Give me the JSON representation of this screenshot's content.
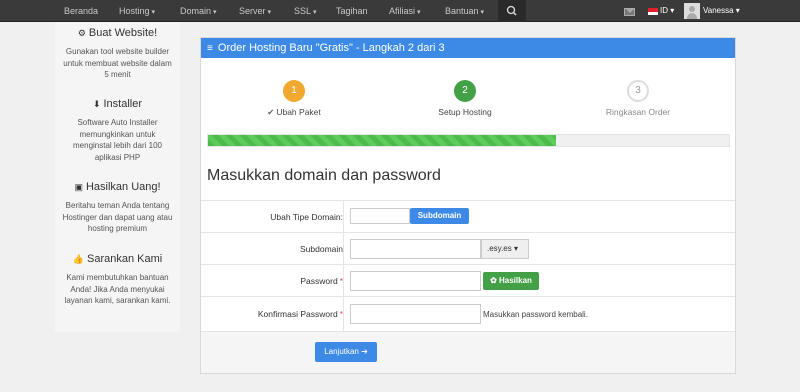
{
  "nav": {
    "items": [
      {
        "label": "Beranda",
        "caret": ""
      },
      {
        "label": "Hosting",
        "caret": "▾"
      },
      {
        "label": "Domain",
        "caret": "▾"
      },
      {
        "label": "Server",
        "caret": "▾"
      },
      {
        "label": "SSL",
        "caret": "▾"
      },
      {
        "label": "Tagihan",
        "caret": ""
      },
      {
        "label": "Afiliasi",
        "caret": "▾"
      },
      {
        "label": "Bantuan",
        "caret": "▾"
      }
    ],
    "search_icon": "⌕",
    "mail_icon": "mail-icon",
    "language": "ID ▾",
    "username": "Vanessa",
    "user_caret": "▾"
  },
  "sidebar": {
    "blocks": [
      {
        "icon": "⚙",
        "title": "Buat Website!",
        "text": "Gunakan tool website builder untuk membuat website dalam 5 menit"
      },
      {
        "icon": "⬇",
        "title": "Installer",
        "text": "Software Auto Installer memungkinkan untuk menginstal lebih dari 100 aplikasi PHP"
      },
      {
        "icon": "▣",
        "title": "Hasilkan Uang!",
        "text": "Beritahu teman Anda tentang Hostinger dan dapat uang atau hosting premium"
      },
      {
        "icon": "👍",
        "title": "Sarankan Kami",
        "text": "Kami membutuhkan bantuan Anda! Jika Anda menyukai layanan kami, sarankan kami."
      }
    ]
  },
  "panel": {
    "icon": "≡",
    "title": "Order Hosting Baru \"Gratis\" - Langkah 2 dari 3"
  },
  "steps": [
    {
      "number": "1",
      "label": "Ubah Paket",
      "check": "✔",
      "color": "#f0a830"
    },
    {
      "number": "2",
      "label": "Setup Hosting",
      "check": "",
      "color": "#43a047"
    },
    {
      "number": "3",
      "label": "Ringkasan Order",
      "check": "",
      "color": "#ffffff"
    }
  ],
  "progress": {
    "fraction": 0.667
  },
  "section_title": "Masukkan domain dan password",
  "form": {
    "domain_type_label": "Ubah Tipe Domain:",
    "domain_type_button": "Subdomain",
    "subdomain_label": "Subdomain",
    "subdomain_value": "",
    "subdomain_suffix": ".esy.es ▾",
    "password_label": "Password",
    "password_value": "",
    "generate_button": "✿ Hasilkan",
    "confirm_label": "Konfirmasi Password",
    "confirm_value": "",
    "confirm_hint": "Masukkan password kembali.",
    "required_mark": "*"
  },
  "submit_button": "Lanjutkan ➔"
}
